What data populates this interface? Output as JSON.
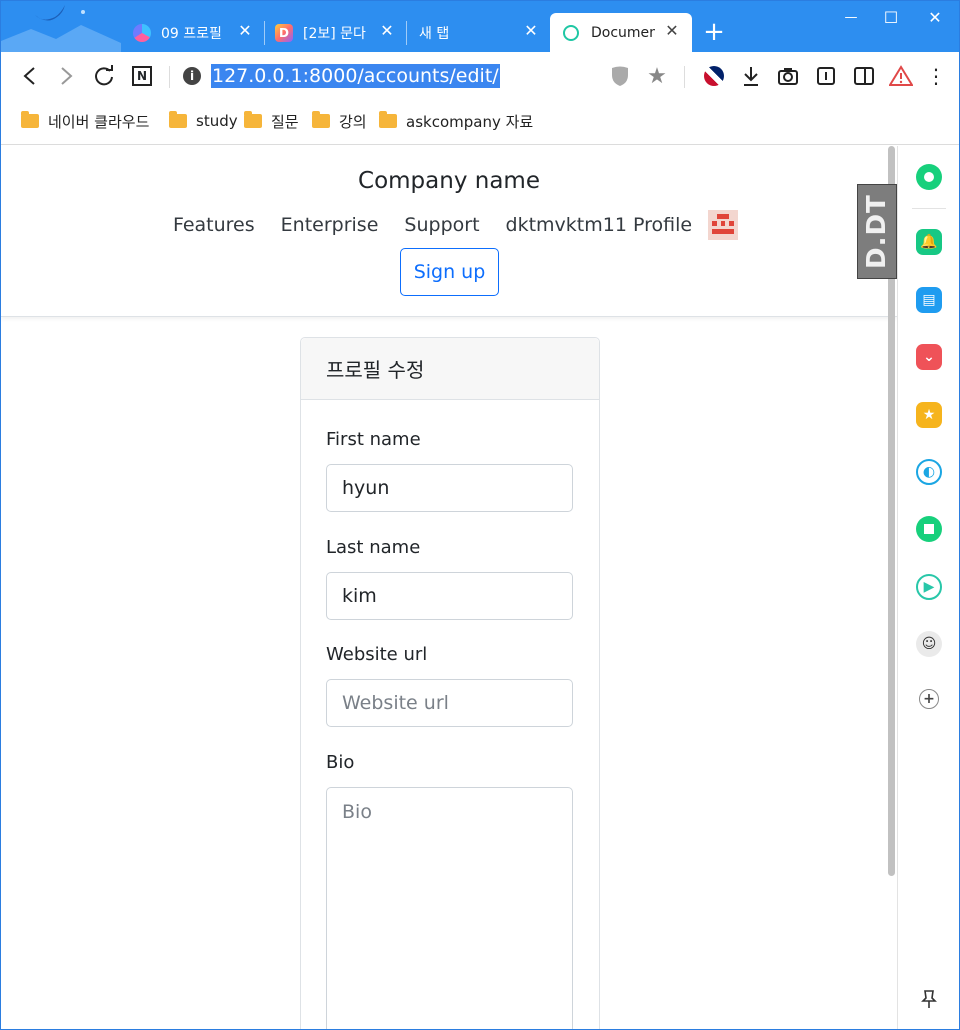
{
  "browser": {
    "tabs": [
      {
        "title": "09 프로필",
        "active": false
      },
      {
        "title": "[2보] 문다",
        "active": false
      },
      {
        "title": "새 탭",
        "active": false
      },
      {
        "title": "Document",
        "active": true
      }
    ],
    "new_tab": "+",
    "window_controls": {
      "minimize": "—",
      "maximize": "☐",
      "close": "✕"
    },
    "url": "127.0.0.1:8000/accounts/edit/",
    "bookmarks": [
      "네이버 클라우드",
      "study",
      "질문",
      "강의",
      "askcompany 자료"
    ]
  },
  "site": {
    "brand": "Company name",
    "nav": [
      "Features",
      "Enterprise",
      "Support",
      "dktmvktm11 Profile"
    ],
    "signup_label": "Sign up"
  },
  "form": {
    "title": "프로필 수정",
    "fields": [
      {
        "label": "First name",
        "value": "hyun",
        "placeholder": ""
      },
      {
        "label": "Last name",
        "value": "kim",
        "placeholder": ""
      },
      {
        "label": "Website url",
        "value": "",
        "placeholder": "Website url"
      },
      {
        "label": "Bio",
        "value": "",
        "placeholder": "Bio"
      }
    ]
  },
  "extension_badge": "D.DT",
  "colors": {
    "tabstrip": "#2d8ef0",
    "primary": "#0d6efd",
    "url_highlight": "#3b86f0"
  }
}
